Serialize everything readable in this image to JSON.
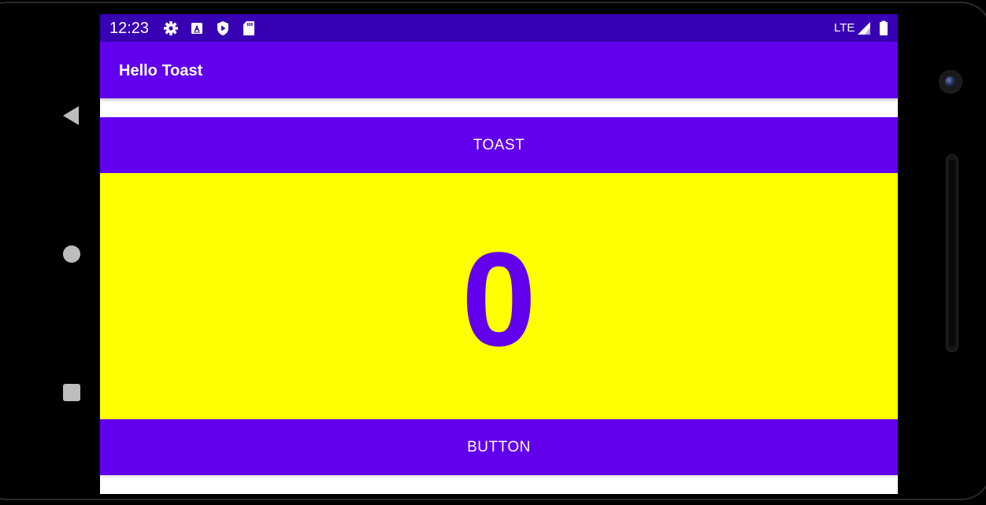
{
  "status_bar": {
    "time": "12:23",
    "network": "LTE",
    "icons": [
      "settings-icon",
      "a-icon",
      "play-protect-icon",
      "sd-card-icon",
      "signal-icon",
      "battery-icon"
    ]
  },
  "app_bar": {
    "title": "Hello Toast"
  },
  "main": {
    "toast_button_label": "TOAST",
    "count_value": "0",
    "count_button_label": "BUTTON"
  },
  "colors": {
    "status_bar": "#3700b3",
    "primary": "#6200ee",
    "count_background": "#ffff00",
    "on_primary": "#ffffff"
  },
  "nav_bar": {
    "icons": [
      "back-icon",
      "home-icon",
      "recents-icon"
    ]
  }
}
